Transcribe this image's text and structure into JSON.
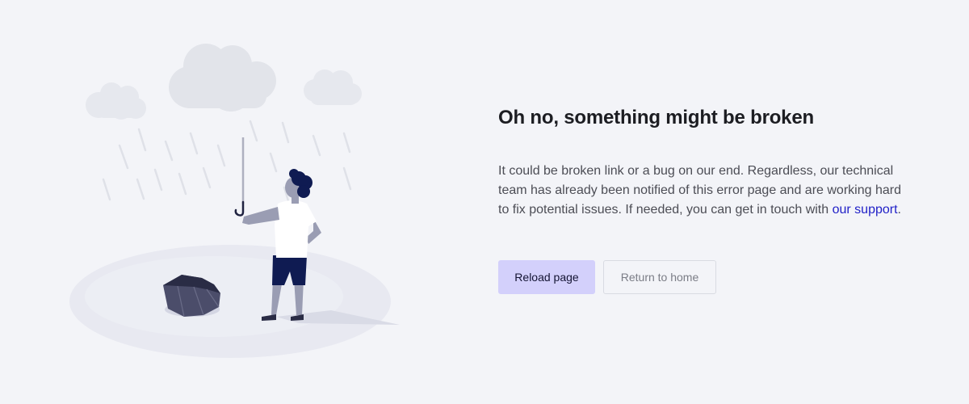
{
  "error": {
    "title": "Oh no, something might be broken",
    "message_prefix": "It could be broken link or a bug on our end. Regardless, our technical team has already been notified of this error page and are working hard to fix potential issues. If needed, you can get in touch with ",
    "support_link": "our support",
    "message_suffix": "."
  },
  "actions": {
    "reload_label": "Reload page",
    "home_label": "Return to home"
  },
  "colors": {
    "background": "#f3f4f8",
    "primary_button": "#d3d0fb",
    "link": "#1f1fc7",
    "figure_dark": "#0f1b52"
  }
}
